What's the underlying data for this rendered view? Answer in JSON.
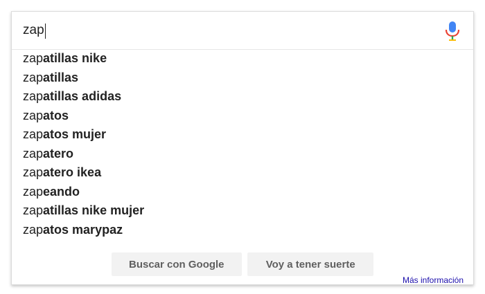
{
  "search": {
    "value": "zap"
  },
  "icons": {
    "mic": "microphone-icon"
  },
  "colors": {
    "mic_blue": "#4285f4",
    "mic_red": "#ea4335",
    "mic_yellow": "#fbbc05",
    "mic_green": "#34a853",
    "link": "#1a0dab"
  },
  "suggestions": [
    {
      "prefix": "zap",
      "completion": "atillas nike"
    },
    {
      "prefix": "zap",
      "completion": "atillas"
    },
    {
      "prefix": "zap",
      "completion": "atillas adidas"
    },
    {
      "prefix": "zap",
      "completion": "atos"
    },
    {
      "prefix": "zap",
      "completion": "atos mujer"
    },
    {
      "prefix": "zap",
      "completion": "atero"
    },
    {
      "prefix": "zap",
      "completion": "atero ikea"
    },
    {
      "prefix": "zap",
      "completion": "eando"
    },
    {
      "prefix": "zap",
      "completion": "atillas nike mujer"
    },
    {
      "prefix": "zap",
      "completion": "atos marypaz"
    }
  ],
  "buttons": {
    "search": "Buscar con Google",
    "lucky": "Voy a tener suerte"
  },
  "more_info": "Más información"
}
